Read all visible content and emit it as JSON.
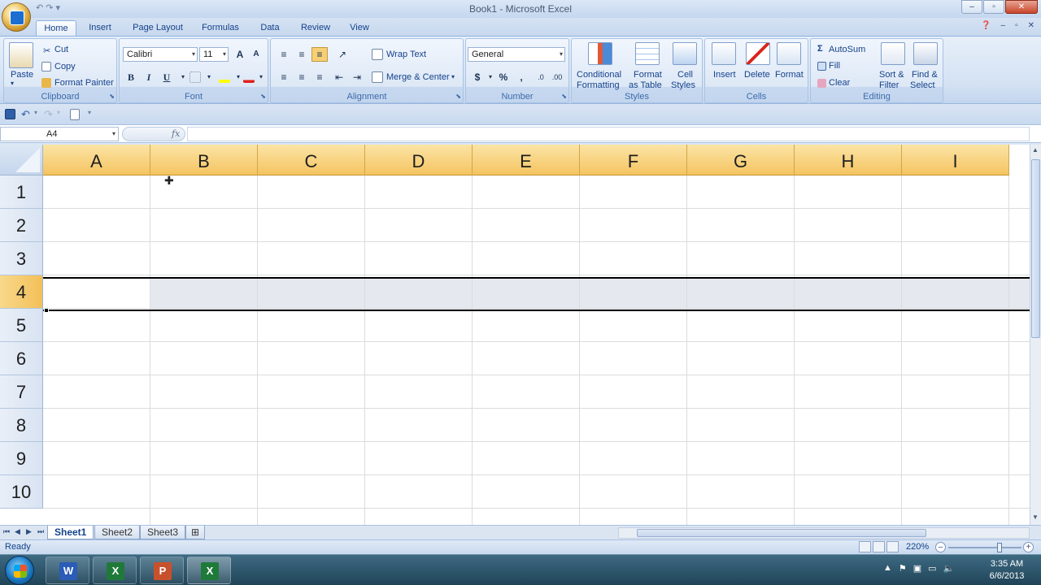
{
  "window": {
    "title": "Book1 - Microsoft Excel",
    "minimize": "–",
    "maximize": "▫",
    "close": "✕"
  },
  "qat_mini": "↶ ↷ ▾",
  "tabs": [
    "Home",
    "Insert",
    "Page Layout",
    "Formulas",
    "Data",
    "Review",
    "View"
  ],
  "ribbon": {
    "clipboard": {
      "label": "Clipboard",
      "paste": "Paste",
      "cut": "Cut",
      "copy": "Copy",
      "format_painter": "Format Painter"
    },
    "font": {
      "label": "Font",
      "name": "Calibri",
      "size": "11",
      "bold": "B",
      "italic": "I",
      "underline": "U",
      "grow": "A",
      "shrink": "A"
    },
    "alignment": {
      "label": "Alignment",
      "wrap_text": "Wrap Text",
      "merge_center": "Merge & Center"
    },
    "number": {
      "label": "Number",
      "format": "General",
      "currency": "$",
      "percent": "%",
      "comma": ","
    },
    "styles": {
      "label": "Styles",
      "conditional": "Conditional",
      "formatting": "Formatting",
      "format_as": "Format",
      "as_table": "as Table",
      "cell": "Cell",
      "cell_styles": "Styles"
    },
    "cells": {
      "label": "Cells",
      "insert": "Insert",
      "delete": "Delete",
      "format": "Format"
    },
    "editing": {
      "label": "Editing",
      "autosum": "AutoSum",
      "fill": "Fill",
      "clear": "Clear",
      "sort": "Sort &",
      "filter": "Filter",
      "find": "Find &",
      "select": "Select"
    }
  },
  "formula_bar": {
    "name_box": "A4",
    "fx": "fx",
    "formula": ""
  },
  "columns": [
    "A",
    "B",
    "C",
    "D",
    "E",
    "F",
    "G",
    "H",
    "I"
  ],
  "rows": [
    "1",
    "2",
    "3",
    "4",
    "5",
    "6",
    "7",
    "8",
    "9",
    "10"
  ],
  "selected": {
    "row": "4",
    "cell": "A4"
  },
  "sheets": [
    "Sheet1",
    "Sheet2",
    "Sheet3"
  ],
  "status": {
    "ready": "Ready",
    "zoom": "220%"
  },
  "taskbar": {
    "time": "3:35 AM",
    "date": "6/6/2013"
  },
  "colors": {
    "ribbon_bg": "#d4e2f3",
    "header_selected": "#f5c461",
    "accent": "#15428b"
  }
}
